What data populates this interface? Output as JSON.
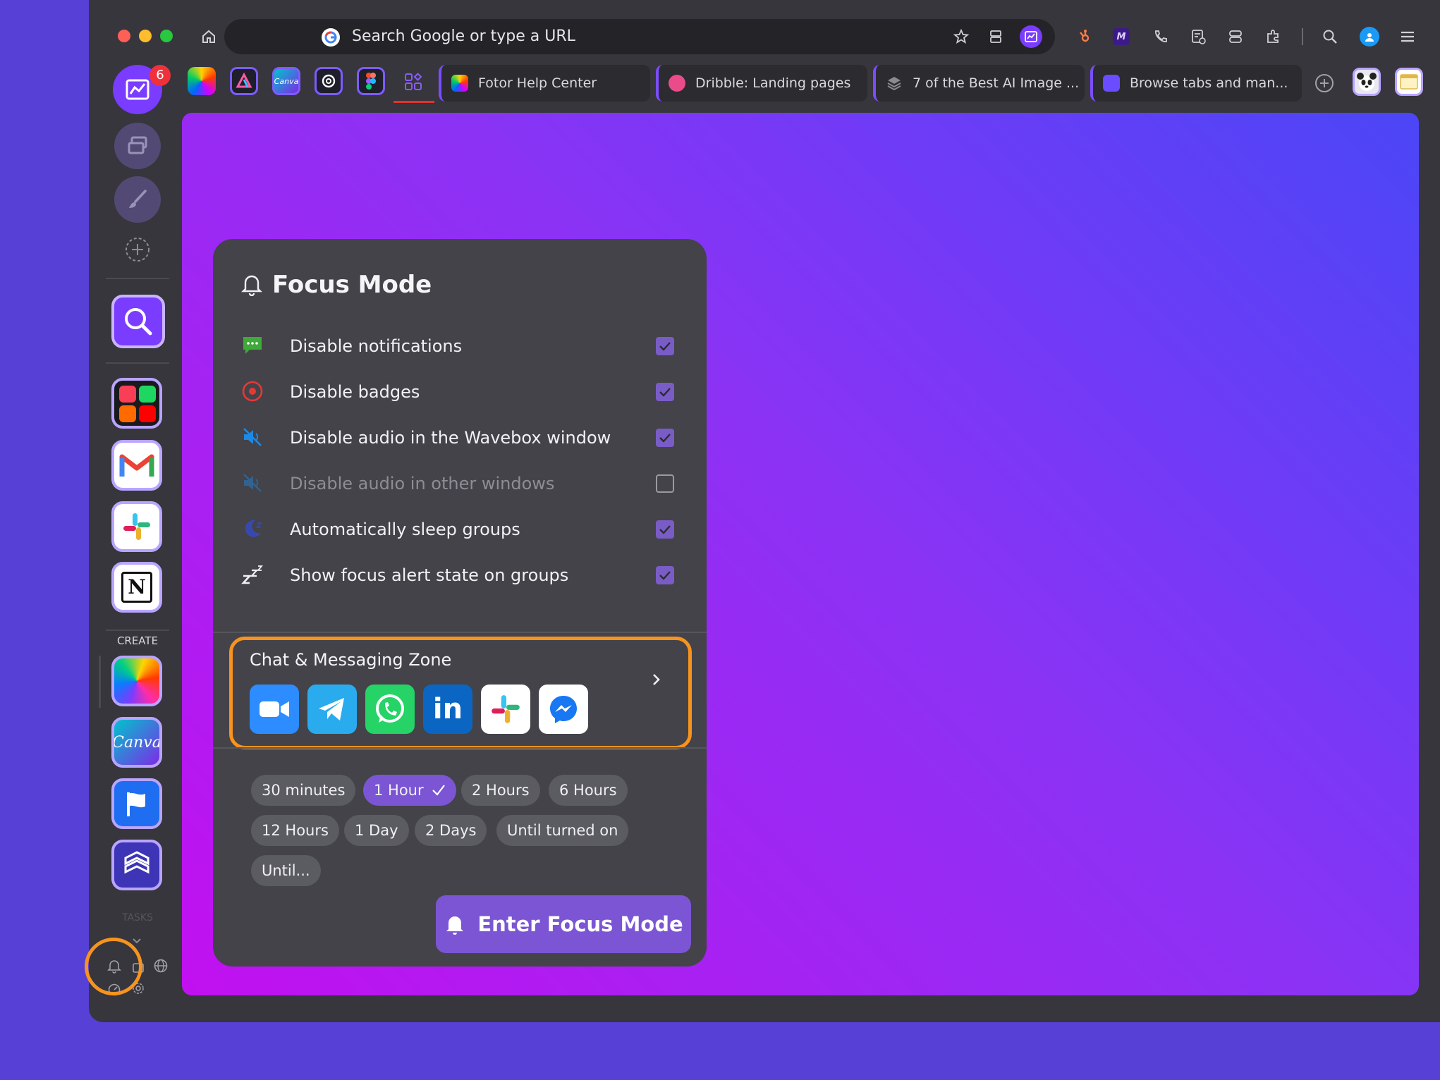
{
  "browser": {
    "url_placeholder": "Search Google or type a URL",
    "profile_badge": "6",
    "tabs": [
      {
        "title": "Fotor Help Center"
      },
      {
        "title": "Dribble: Landing pages"
      },
      {
        "title": "7 of the Best AI Image ..."
      },
      {
        "title": "Browse tabs and man..."
      }
    ]
  },
  "sidebar": {
    "create_label": "CREATE",
    "tasks_label": "TASKS"
  },
  "focus": {
    "title": "Focus Mode",
    "options": [
      {
        "label": "Disable notifications",
        "checked": true,
        "icon": "message-icon"
      },
      {
        "label": "Disable badges",
        "checked": true,
        "icon": "badge-target-icon"
      },
      {
        "label": "Disable audio in the Wavebox window",
        "checked": true,
        "icon": "mute-icon"
      },
      {
        "label": "Disable audio in other windows",
        "checked": false,
        "icon": "mute-icon"
      },
      {
        "label": "Automatically sleep groups",
        "checked": true,
        "icon": "moon-icon"
      },
      {
        "label": "Show focus alert state on groups",
        "checked": true,
        "icon": "zzz-icon"
      }
    ],
    "zone_title": "Chat & Messaging Zone",
    "durations": [
      "30 minutes",
      "1 Hour",
      "2 Hours",
      "6 Hours",
      "12 Hours",
      "1 Day",
      "2 Days",
      "Until turned on",
      "Until..."
    ],
    "selected_duration": "1 Hour",
    "enter_label": "Enter Focus Mode"
  },
  "colors": {
    "accent": "#7b55d4",
    "highlight": "#f7931e",
    "panel": "#434349"
  }
}
